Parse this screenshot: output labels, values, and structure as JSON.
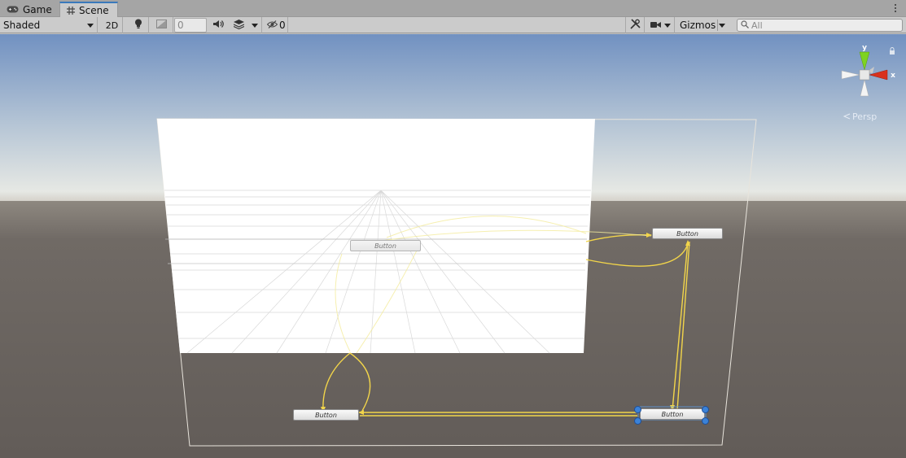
{
  "tabs": [
    {
      "label": "Game",
      "icon": "gamepad-icon",
      "active": false
    },
    {
      "label": "Scene",
      "icon": "grid-hash-icon",
      "active": true
    }
  ],
  "toolbar": {
    "draw_mode": "Shaded",
    "mode_2d": "2D",
    "fx_value": "0",
    "hidden_count": "0",
    "gizmos_label": "Gizmos",
    "search_placeholder": "All"
  },
  "orientation_gizmo": {
    "y_label": "y",
    "x_label": "x",
    "projection_label": "Persp",
    "colors": {
      "y": "#7ed321",
      "x": "#d8311d",
      "center": "#e8e8e8"
    }
  },
  "scene_buttons": [
    {
      "label": "Button",
      "state": "faded"
    },
    {
      "label": "Button",
      "state": "normal"
    },
    {
      "label": "Button",
      "state": "normal"
    },
    {
      "label": "Button",
      "state": "selected"
    }
  ],
  "colors": {
    "accent": "#3a79bb",
    "sky_top": "#7394c4",
    "ground": "#6b6460",
    "navigation_lines": "#f2d54a",
    "selection_handles": "#3b82d8"
  }
}
